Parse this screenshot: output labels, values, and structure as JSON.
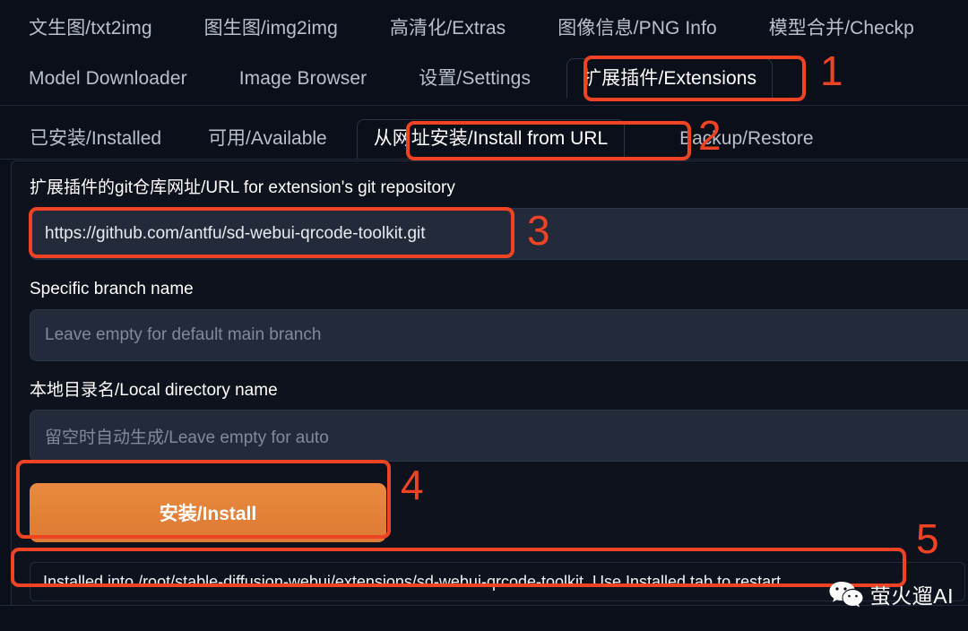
{
  "app": {
    "theme_bg": "#0b0f19",
    "panel_bg": "#0d121d",
    "accent_orange": "#e0813c",
    "annotation_red": "#f04323"
  },
  "main_tabs": {
    "row1": [
      {
        "label": "文生图/txt2img",
        "active": false
      },
      {
        "label": "图生图/img2img",
        "active": false
      },
      {
        "label": "高清化/Extras",
        "active": false
      },
      {
        "label": "图像信息/PNG Info",
        "active": false
      },
      {
        "label": "模型合并/Checkp",
        "active": false
      }
    ],
    "row2": [
      {
        "label": "Model Downloader",
        "active": false
      },
      {
        "label": "Image Browser",
        "active": false
      },
      {
        "label": "设置/Settings",
        "active": false
      },
      {
        "label": "扩展插件/Extensions",
        "active": true
      }
    ]
  },
  "sub_tabs": [
    {
      "label": "已安装/Installed",
      "active": false
    },
    {
      "label": "可用/Available",
      "active": false
    },
    {
      "label": "从网址安装/Install from URL",
      "active": true
    },
    {
      "label": "Backup/Restore",
      "active": false
    }
  ],
  "form": {
    "url_label": "扩展插件的git仓库网址/URL for extension's git repository",
    "url_value": "https://github.com/antfu/sd-webui-qrcode-toolkit.git",
    "branch_label": "Specific branch name",
    "branch_value": "",
    "branch_placeholder": "Leave empty for default main branch",
    "local_label": "本地目录名/Local directory name",
    "local_value": "",
    "local_placeholder": "留空时自动生成/Leave empty for auto",
    "install_button": "安装/Install"
  },
  "status": {
    "message": "Installed into /root/stable-diffusion-webui/extensions/sd-webui-qrcode-toolkit. Use Installed tab to restart."
  },
  "annotations": [
    {
      "number": "1",
      "target": "extensions-tab"
    },
    {
      "number": "2",
      "target": "install-from-url-tab"
    },
    {
      "number": "3",
      "target": "url-input"
    },
    {
      "number": "4",
      "target": "install-button"
    },
    {
      "number": "5",
      "target": "status-bar"
    }
  ],
  "watermark": {
    "text": "萤火遛AI",
    "icon": "wechat-icon"
  }
}
